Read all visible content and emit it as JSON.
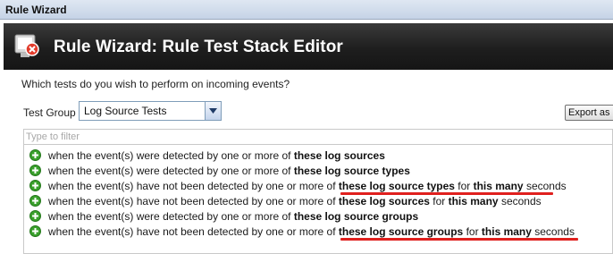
{
  "window": {
    "title": "Rule Wizard"
  },
  "banner": {
    "title": "Rule Wizard: Rule Test Stack Editor",
    "logo_icon": "rule-wizard-logo-icon"
  },
  "prompt": {
    "question": "Which tests do you wish to perform on incoming events?"
  },
  "test_group": {
    "label": "Test Group",
    "selected": "Log Source Tests"
  },
  "export_button": {
    "label": "Export as B"
  },
  "filter": {
    "placeholder": "Type to filter",
    "value": ""
  },
  "tests": [
    {
      "pre": "when the event(s) were detected by one or more of ",
      "b1": "these log sources",
      "mid": "",
      "b2": "",
      "post": ""
    },
    {
      "pre": "when the event(s) were detected by one or more of ",
      "b1": "these log source types",
      "mid": "",
      "b2": "",
      "post": ""
    },
    {
      "pre": "when the event(s) have not been detected by one or more of ",
      "b1": "these log source types",
      "mid": " for ",
      "b2": "this many",
      "post": " seconds"
    },
    {
      "pre": "when the event(s) have not been detected by one or more of ",
      "b1": "these log sources",
      "mid": " for ",
      "b2": "this many",
      "post": " seconds"
    },
    {
      "pre": "when the event(s) were detected by one or more of ",
      "b1": "these log source groups",
      "mid": "",
      "b2": "",
      "post": ""
    },
    {
      "pre": "when the event(s) have not been detected by one or more of ",
      "b1": "these log source groups",
      "mid": " for ",
      "b2": "this many",
      "post": " seconds"
    }
  ],
  "colors": {
    "banner_bg": "#1e1e1e",
    "annotation_underline": "#e0201e",
    "add_icon": "#3aa02c"
  }
}
